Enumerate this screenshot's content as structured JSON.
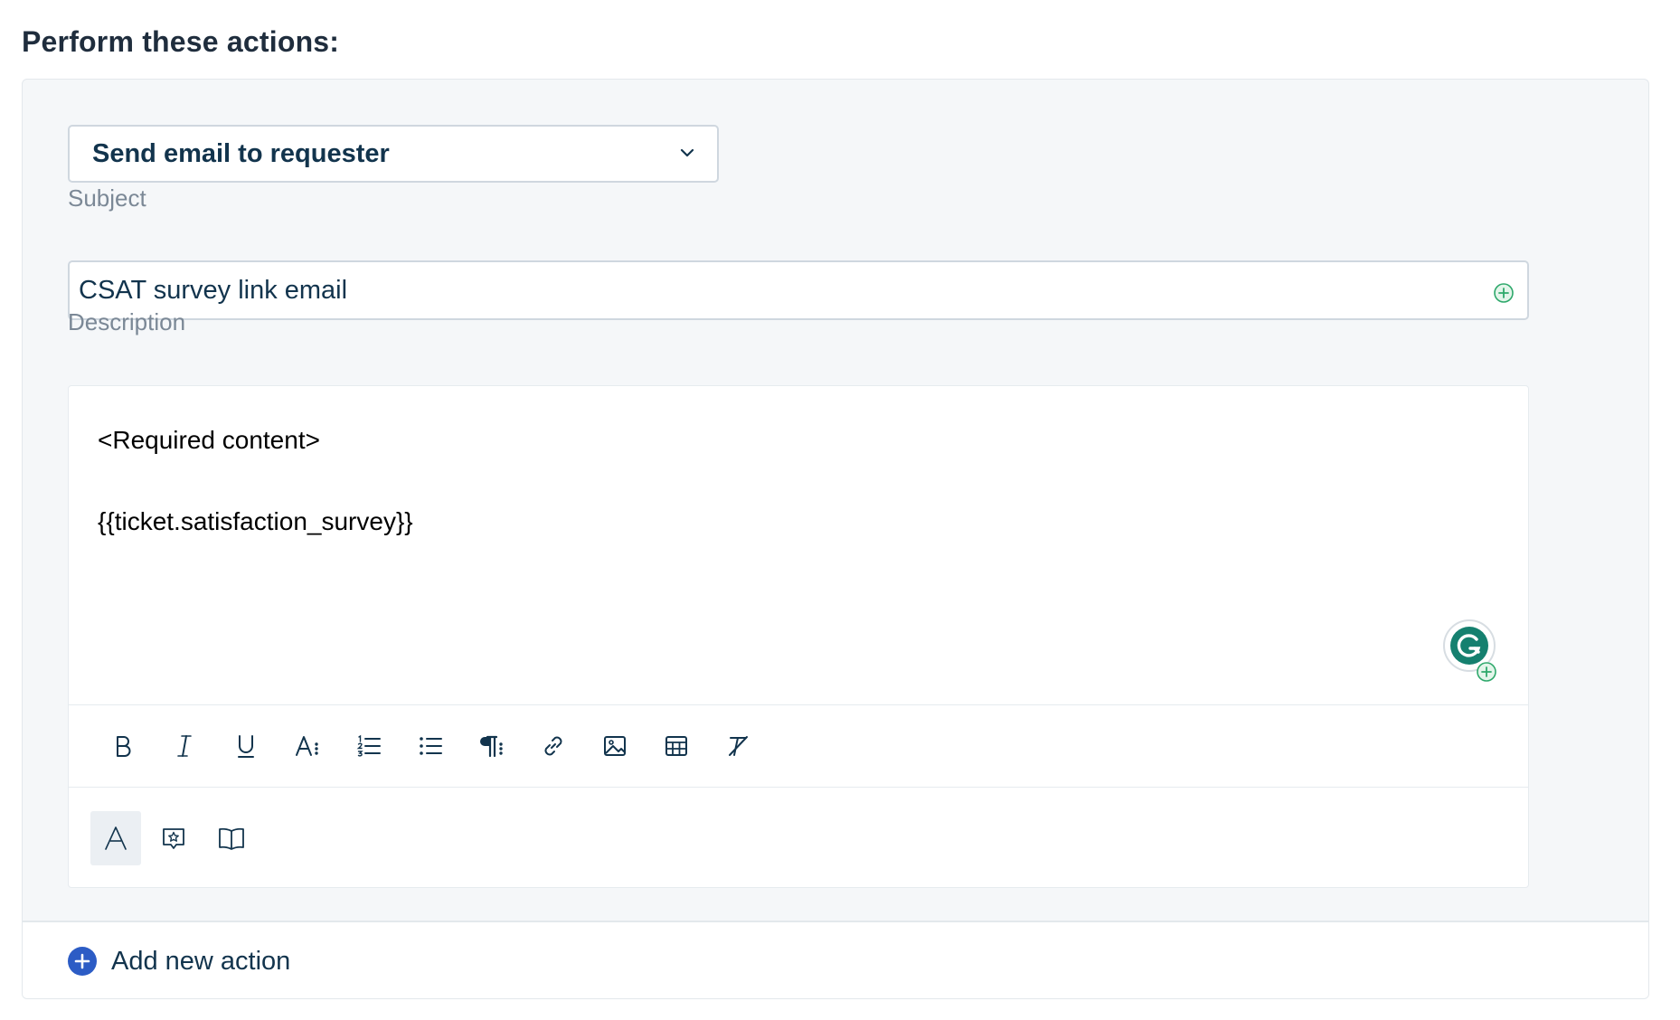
{
  "heading": "Perform these actions:",
  "action": {
    "selected": "Send email to requester"
  },
  "subject": {
    "label": "Subject",
    "value": "CSAT survey link email"
  },
  "description": {
    "label": "Description",
    "lines": [
      "<Required content>",
      "{{ticket.satisfaction_survey}}"
    ]
  },
  "toolbar": {
    "items": [
      "bold-icon",
      "italic-icon",
      "underline-icon",
      "font-size-icon",
      "ordered-list-icon",
      "bullet-list-icon",
      "paragraph-icon",
      "link-icon",
      "image-icon",
      "table-icon",
      "clear-format-icon"
    ]
  },
  "bottom_toolbar": {
    "items": [
      "text-format-icon",
      "canned-response-icon",
      "solution-article-icon"
    ]
  },
  "add_action": {
    "label": "Add new action"
  },
  "colors": {
    "accent": "#2c5cc5",
    "grammarly": "#15806f",
    "add_green": "#2ea86b"
  }
}
